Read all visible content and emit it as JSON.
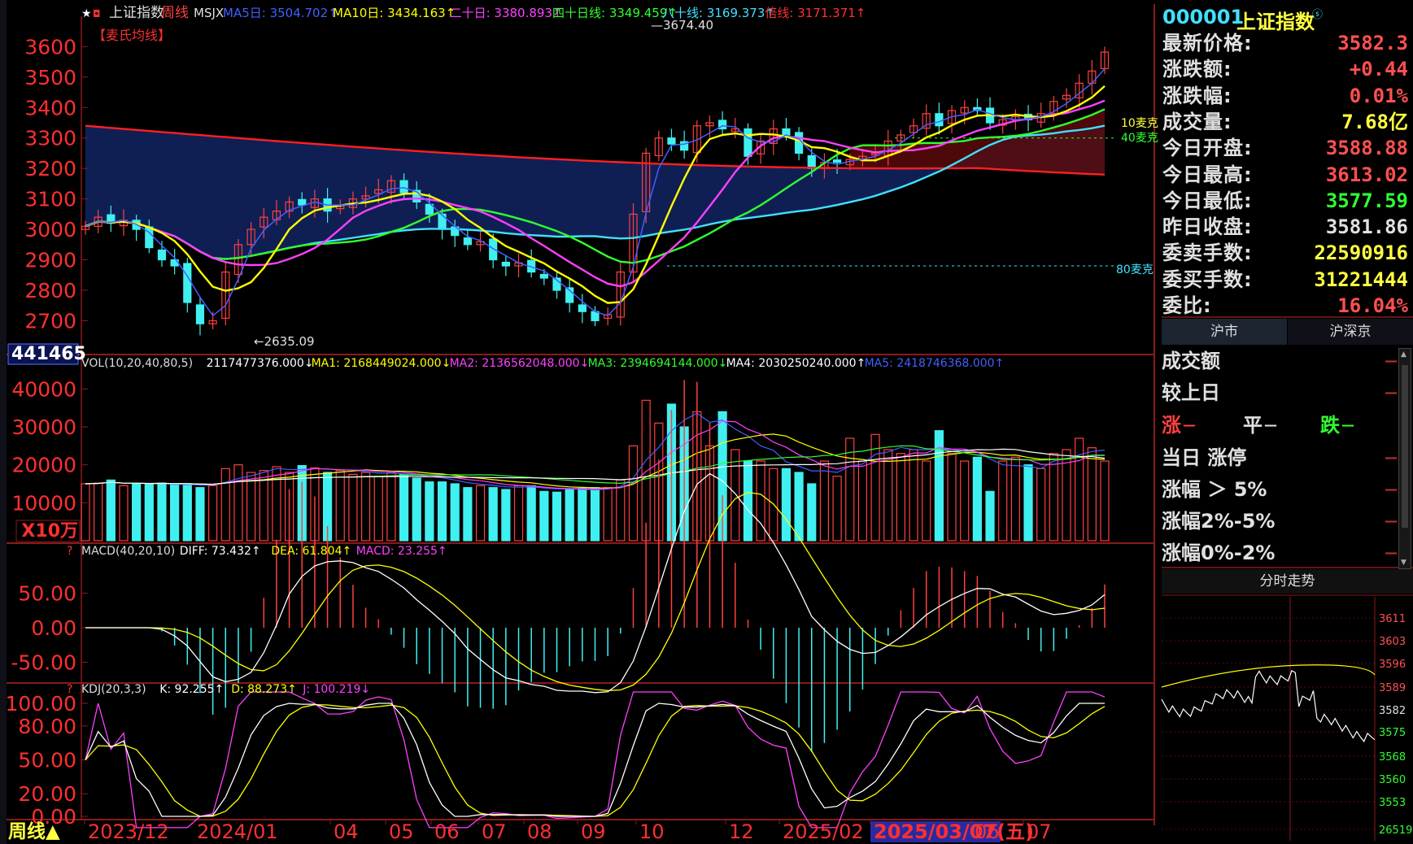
{
  "title_bar": {
    "stock_name": "上证指数",
    "period": "周线",
    "indicator": "MSJX",
    "ma_labels": [
      {
        "text": "MA5日: 3504.702↑",
        "color": "#4060ff"
      },
      {
        "text": "MA10日: 3434.163↑",
        "color": "#ffff00"
      },
      {
        "text": "二十日: 3380.893↑",
        "color": "#ff40ff"
      },
      {
        "text": "四十日线: 3349.459↑",
        "color": "#30ff30"
      },
      {
        "text": "八十线: 3169.373↑",
        "color": "#40e0ff"
      },
      {
        "text": "倍线: 3171.371↑",
        "color": "#ff3030"
      }
    ],
    "tag": "【麦氏均线】"
  },
  "price_chart": {
    "y_ticks": [
      "3600",
      "3500",
      "3400",
      "3300",
      "3200",
      "3100",
      "3000",
      "2900",
      "2800",
      "2700"
    ],
    "high_label": "3674.40",
    "low_label": "2635.09",
    "right_labels": [
      "10麦克",
      "40麦克",
      "80麦克"
    ],
    "left_badge": "441465"
  },
  "vol_panel": {
    "header": [
      {
        "text": "VOL(10,20,40,80,5)",
        "color": "#dddddd"
      },
      {
        "text": "2117477376.000↓",
        "color": "#ffffff"
      },
      {
        "text": "MA1: 2168449024.000↓",
        "color": "#ffff00"
      },
      {
        "text": "MA2: 2136562048.000↓",
        "color": "#ff40ff"
      },
      {
        "text": "MA3: 2394694144.000↓",
        "color": "#30ff30"
      },
      {
        "text": "MA4: 2030250240.000↑",
        "color": "#ffffff"
      },
      {
        "text": "MA5: 2418746368.000↑",
        "color": "#4060ff"
      }
    ],
    "y_ticks": [
      "40000",
      "30000",
      "20000",
      "10000"
    ],
    "unit": "X10万"
  },
  "macd_panel": {
    "header": [
      {
        "text": "MACD(40,20,10)",
        "color": "#dddddd"
      },
      {
        "text": "DIFF: 73.432↑",
        "color": "#ffffff"
      },
      {
        "text": "DEA: 61.804↑",
        "color": "#ffff00"
      },
      {
        "text": "MACD: 23.255↑",
        "color": "#ff40ff"
      }
    ],
    "y_ticks": [
      "50.00",
      "0.00",
      "-50.00"
    ]
  },
  "kdj_panel": {
    "header": [
      {
        "text": "KDJ(20,3,3)",
        "color": "#dddddd"
      },
      {
        "text": "K: 92.255↑",
        "color": "#ffffff"
      },
      {
        "text": "D: 88.273↑",
        "color": "#ffff00"
      },
      {
        "text": "J: 100.219↓",
        "color": "#ff40ff"
      }
    ],
    "y_ticks": [
      "100.00",
      "80.00",
      "50.00",
      "20.00",
      "0.00"
    ]
  },
  "x_axis": {
    "labels": [
      "2023/12",
      "2024/01",
      "04",
      "05",
      "06",
      "07",
      "08",
      "09",
      "10",
      "12",
      "2025/02",
      "2025/03/07(五)",
      "06",
      "07"
    ],
    "period_button": "周线▲"
  },
  "quote": {
    "code": "000001",
    "name": "上证指数",
    "rows": [
      {
        "label": "最新价格:",
        "value": "3582.3",
        "color": "#ff5050"
      },
      {
        "label": "涨跌额:",
        "value": "+0.44",
        "color": "#ff5050"
      },
      {
        "label": "涨跌幅:",
        "value": "0.01%",
        "color": "#ff5050"
      },
      {
        "label": "成交量:",
        "value": "7.68亿",
        "color": "#ffff40"
      },
      {
        "label": "今日开盘:",
        "value": "3588.88",
        "color": "#ff5050"
      },
      {
        "label": "今日最高:",
        "value": "3613.02",
        "color": "#ff5050"
      },
      {
        "label": "今日最低:",
        "value": "3577.59",
        "color": "#30ff30"
      },
      {
        "label": "昨日收盘:",
        "value": "3581.86",
        "color": "#e0e0e0"
      },
      {
        "label": "委卖手数:",
        "value": "22590916",
        "color": "#ffff40"
      },
      {
        "label": "委买手数:",
        "value": "31221444",
        "color": "#ffff40"
      },
      {
        "label": "委比:",
        "value": "16.04%",
        "color": "#ff5050"
      }
    ]
  },
  "tabs": [
    "沪市",
    "沪深京"
  ],
  "stats": {
    "turnover": "成交额",
    "vs_prev": "较上日",
    "up": "涨",
    "flat": "平",
    "down": "跌",
    "dash": "—",
    "limit_up": "当日 涨停",
    "gt5": "涨幅 ＞ 5%",
    "r2to5": "涨幅2%-5%",
    "r0to2": "涨幅0%-2%"
  },
  "intraday": {
    "title": "分时走势",
    "y_ticks": [
      "3611",
      "3603",
      "3596",
      "3589",
      "3582",
      "3575",
      "3568",
      "3560",
      "3553",
      "26519"
    ]
  },
  "chart_data": {
    "type": "candlestick",
    "title": "上证指数 周线",
    "ylim": [
      2635.09,
      3674.4
    ],
    "y_ticks": [
      2700,
      2800,
      2900,
      3000,
      3100,
      3200,
      3300,
      3400,
      3500,
      3600
    ],
    "close": [
      3010,
      3040,
      3020,
      3030,
      3000,
      2940,
      2900,
      2880,
      2760,
      2690,
      2700,
      2860,
      2950,
      3000,
      3040,
      3060,
      3090,
      3080,
      3100,
      3060,
      3080,
      3100,
      3110,
      3130,
      3160,
      3120,
      3090,
      3050,
      3000,
      2980,
      2950,
      2960,
      2900,
      2880,
      2890,
      2860,
      2840,
      2800,
      2760,
      2730,
      2700,
      2720,
      2860,
      3050,
      3250,
      3300,
      3280,
      3260,
      3340,
      3350,
      3330,
      3330,
      3240,
      3290,
      3330,
      3310,
      3250,
      3200,
      3220,
      3220,
      3230,
      3240,
      3250,
      3290,
      3310,
      3340,
      3380,
      3340,
      3390,
      3400,
      3390,
      3350,
      3360,
      3370,
      3360,
      3380,
      3420,
      3440,
      3480,
      3520,
      3582
    ],
    "volume_x10w": [
      15000,
      15200,
      16000,
      14500,
      15000,
      14800,
      15200,
      14800,
      14600,
      14000,
      14500,
      19000,
      20000,
      18000,
      18500,
      19500,
      18000,
      19800,
      19200,
      18000,
      18500,
      17500,
      18000,
      17000,
      18000,
      17500,
      16500,
      15500,
      15500,
      15000,
      14000,
      14500,
      14000,
      13500,
      14500,
      14500,
      13000,
      12800,
      13500,
      13800,
      14000,
      14000,
      16000,
      25000,
      37000,
      31000,
      36000,
      30000,
      34000,
      25000,
      34000,
      24000,
      21000,
      21000,
      19000,
      19000,
      18000,
      15000,
      21000,
      17000,
      27000,
      21000,
      28000,
      24000,
      23000,
      24000,
      21000,
      29000,
      23000,
      21000,
      22000,
      13000,
      21000,
      22000,
      20000,
      19000,
      23000,
      24000,
      27000,
      24500,
      21000
    ],
    "ma_lines": [
      {
        "name": "MA5",
        "value": 3504.702
      },
      {
        "name": "MA10",
        "value": 3434.163
      },
      {
        "name": "MA20",
        "value": 3380.893
      },
      {
        "name": "MA40",
        "value": 3349.459
      },
      {
        "name": "MA80",
        "value": 3169.373
      },
      {
        "name": "倍线",
        "value": 3171.371
      }
    ],
    "macd": {
      "diff": 73.432,
      "dea": 61.804,
      "macd": 23.255
    },
    "kdj": {
      "k": 92.255,
      "d": 88.273,
      "j": 100.219
    }
  }
}
